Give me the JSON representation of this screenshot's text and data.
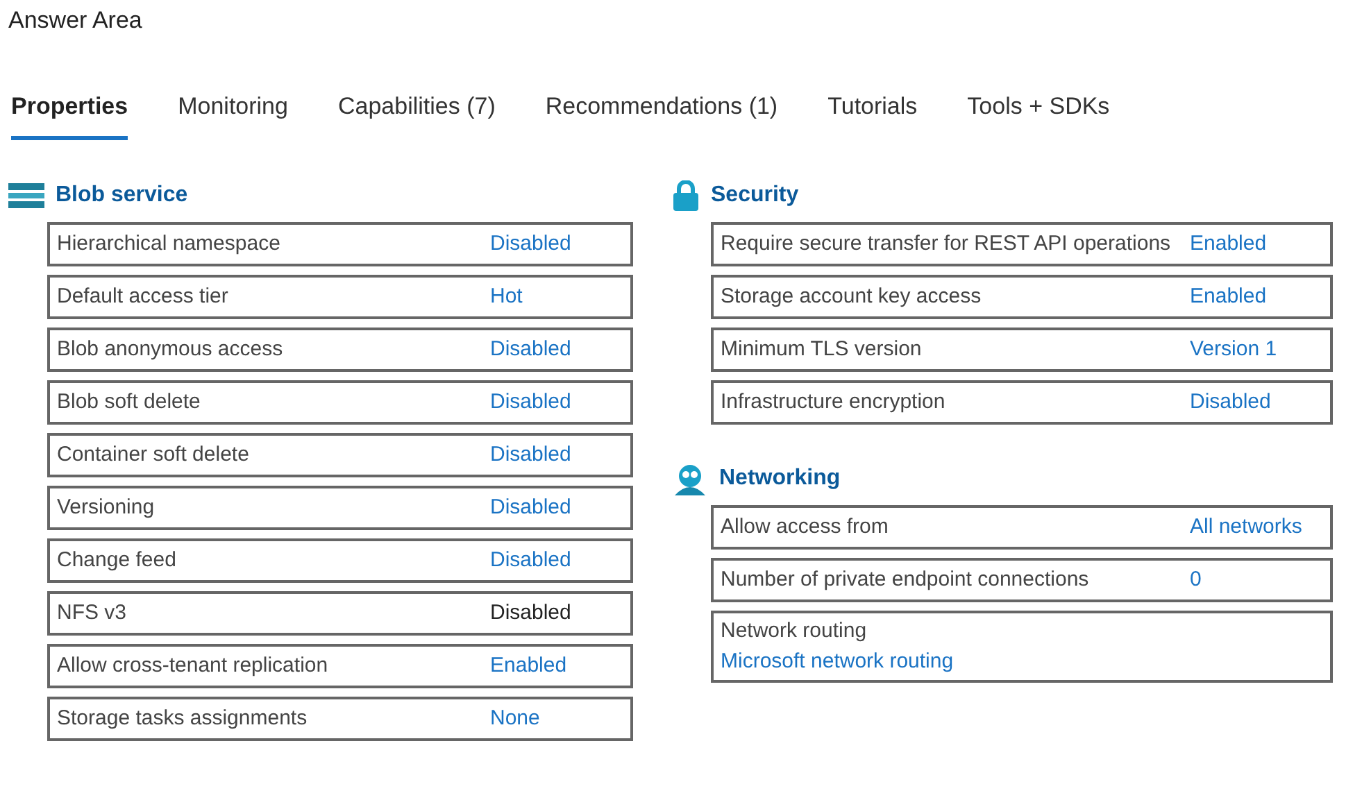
{
  "title": "Answer Area",
  "tabs": [
    {
      "label": "Properties",
      "selected": true
    },
    {
      "label": "Monitoring",
      "selected": false
    },
    {
      "label": "Capabilities (7)",
      "selected": false
    },
    {
      "label": "Recommendations (1)",
      "selected": false
    },
    {
      "label": "Tutorials",
      "selected": false
    },
    {
      "label": "Tools + SDKs",
      "selected": false
    }
  ],
  "sections": [
    {
      "title": "Blob service",
      "rows": [
        {
          "kind": "inline",
          "label": "Hierarchical namespace",
          "value": "Disabled",
          "link": true
        },
        {
          "kind": "inline",
          "label": "Default access tier",
          "value": "Hot",
          "link": true
        },
        {
          "kind": "inline",
          "label": "Blob anonymous access",
          "value": "Disabled",
          "link": true
        },
        {
          "kind": "inline",
          "label": "Blob soft delete",
          "value": "Disabled",
          "link": true
        },
        {
          "kind": "inline",
          "label": "Container soft delete",
          "value": "Disabled",
          "link": true
        },
        {
          "kind": "inline",
          "label": "Versioning",
          "value": "Disabled",
          "link": true
        },
        {
          "kind": "inline",
          "label": "Change feed",
          "value": "Disabled",
          "link": true
        },
        {
          "kind": "inline",
          "label": "NFS v3",
          "value": "Disabled",
          "link": false
        },
        {
          "kind": "inline",
          "label": "Allow cross-tenant replication",
          "value": "Enabled",
          "link": true
        },
        {
          "kind": "inline",
          "label": "Storage tasks assignments",
          "value": "None",
          "link": true
        }
      ]
    },
    {
      "title": "Security",
      "rows": [
        {
          "kind": "inline",
          "label": "Require secure transfer for REST API operations",
          "value": "Enabled",
          "link": true
        },
        {
          "kind": "inline",
          "label": "Storage account key access",
          "value": "Enabled",
          "link": true
        },
        {
          "kind": "inline",
          "label": "Minimum TLS version",
          "value": "Version 1",
          "link": true
        },
        {
          "kind": "inline",
          "label": "Infrastructure encryption",
          "value": "Disabled",
          "link": true
        }
      ]
    },
    {
      "title": "Networking",
      "rows": [
        {
          "kind": "inline",
          "label": "Allow access from",
          "value": "All networks",
          "link": true
        },
        {
          "kind": "inline",
          "label": "Number of private endpoint connections",
          "value": "0",
          "link": true
        },
        {
          "kind": "stacked",
          "label": "Network routing",
          "value": "Microsoft network routing",
          "link": true
        }
      ]
    }
  ]
}
